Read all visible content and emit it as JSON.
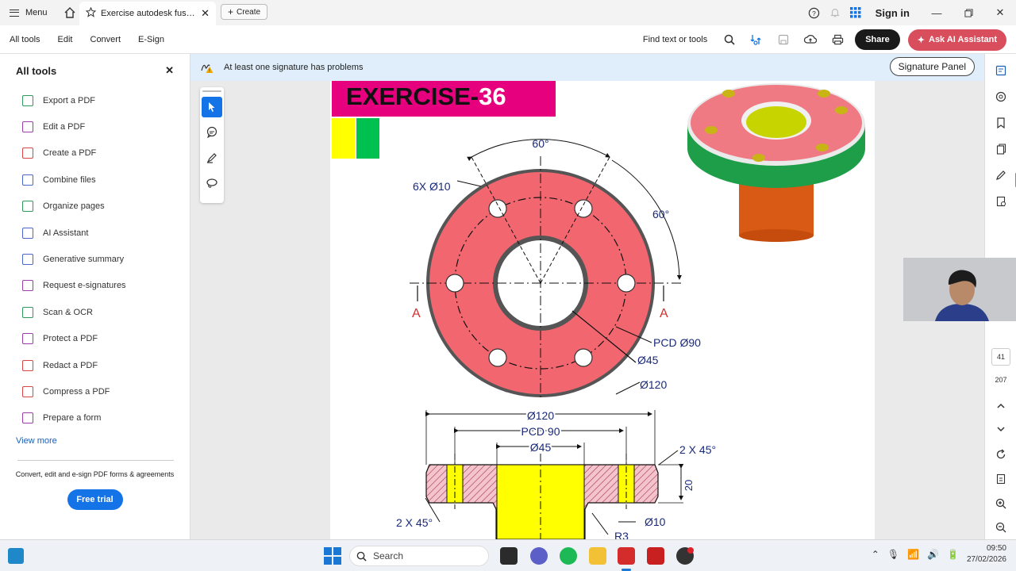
{
  "titlebar": {
    "menu_label": "Menu",
    "tab_title": "Exercise autodesk fusion...",
    "create_label": "Create",
    "signin_label": "Sign in"
  },
  "toolbar": {
    "items": [
      "All tools",
      "Edit",
      "Convert",
      "E-Sign"
    ],
    "find_label": "Find text or tools",
    "share_label": "Share",
    "ai_label": "Ask AI Assistant"
  },
  "left_panel": {
    "title": "All tools",
    "items": [
      {
        "label": "Export a PDF",
        "color": "#2f9a5b"
      },
      {
        "label": "Edit a PDF",
        "color": "#9b3fa8"
      },
      {
        "label": "Create a PDF",
        "color": "#d94545"
      },
      {
        "label": "Combine files",
        "color": "#4a67c9"
      },
      {
        "label": "Organize pages",
        "color": "#2f9a5b"
      },
      {
        "label": "AI Assistant",
        "color": "#4a67c9"
      },
      {
        "label": "Generative summary",
        "color": "#4a67c9"
      },
      {
        "label": "Request e-signatures",
        "color": "#9b3fa8"
      },
      {
        "label": "Scan & OCR",
        "color": "#2f9a5b"
      },
      {
        "label": "Protect a PDF",
        "color": "#9b3fa8"
      },
      {
        "label": "Redact a PDF",
        "color": "#d94545"
      },
      {
        "label": "Compress a PDF",
        "color": "#d94545"
      },
      {
        "label": "Prepare a form",
        "color": "#9b3fa8"
      }
    ],
    "view_more": "View more",
    "promo_text": "Convert, edit and e-sign PDF forms & agreements",
    "free_trial": "Free trial"
  },
  "signature_bar": {
    "message": "At least one signature has problems",
    "panel_button": "Signature Panel"
  },
  "drawing": {
    "title_part1": "EXERCISE-",
    "title_part2": "36",
    "angle_top": "60°",
    "angle_right": "60°",
    "holes": "6X Ø10",
    "section_left": "A",
    "section_right": "A",
    "pcd_label": "PCD Ø90",
    "dia45": "Ø45",
    "dia120": "Ø120",
    "sec_dia120": "Ø120",
    "sec_pcd": "PCD 90",
    "sec_dia45": "Ø45",
    "chamfer_right": "2 X 45°",
    "chamfer_left": "2 X 45°",
    "height20": "20",
    "sec_dia10": "Ø10",
    "r3": "R3"
  },
  "right_rail": {
    "current_page": "41",
    "total_pages": "207"
  },
  "taskbar": {
    "search_placeholder": "Search",
    "time": "09:50",
    "date": "27/02/2026"
  }
}
